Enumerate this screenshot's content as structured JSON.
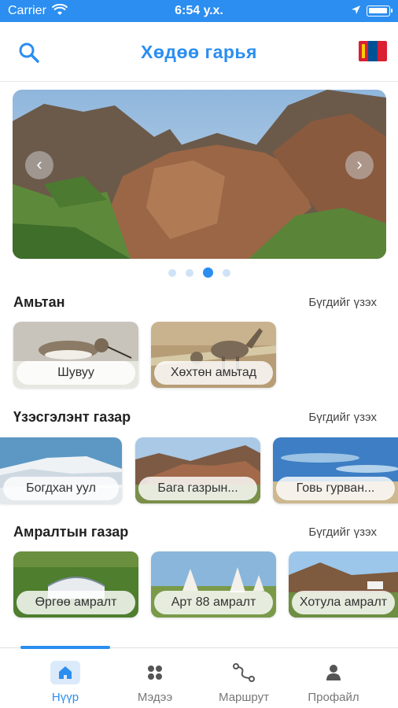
{
  "status_bar": {
    "carrier": "Carrier",
    "time": "6:54 у.х."
  },
  "header": {
    "title": "Хөдөө гарья",
    "flag_icon": "mongolia-flag-icon",
    "search_icon": "search-icon"
  },
  "carousel": {
    "slide_count": 4,
    "active_index": 2,
    "prev_icon": "chevron-left-icon",
    "next_icon": "chevron-right-icon"
  },
  "sections": {
    "animals": {
      "title": "Амьтан",
      "see_all": "Бүгдийг үзэх",
      "items": [
        "Шувуу",
        "Хөхтөн амьтад"
      ]
    },
    "sights": {
      "title": "Үзэсгэлэнт газар",
      "see_all": "Бүгдийг үзэх",
      "items": [
        "Богдхан уул",
        "Бага газрын...",
        "Говь гурван..."
      ]
    },
    "resorts": {
      "title": "Амралтын газар",
      "see_all": "Бүгдийг үзэх",
      "items": [
        "Өргөө амралт",
        "Арт 88 амралт",
        "Хотула амралт"
      ]
    }
  },
  "tabbar": {
    "tabs": [
      {
        "label": "Нүүр",
        "icon": "home-icon",
        "active": true
      },
      {
        "label": "Мэдээ",
        "icon": "grid-icon",
        "active": false
      },
      {
        "label": "Маршрут",
        "icon": "route-icon",
        "active": false
      },
      {
        "label": "Профайл",
        "icon": "profile-icon",
        "active": false
      }
    ]
  },
  "colors": {
    "accent": "#2b8ef0",
    "text": "#222222"
  }
}
